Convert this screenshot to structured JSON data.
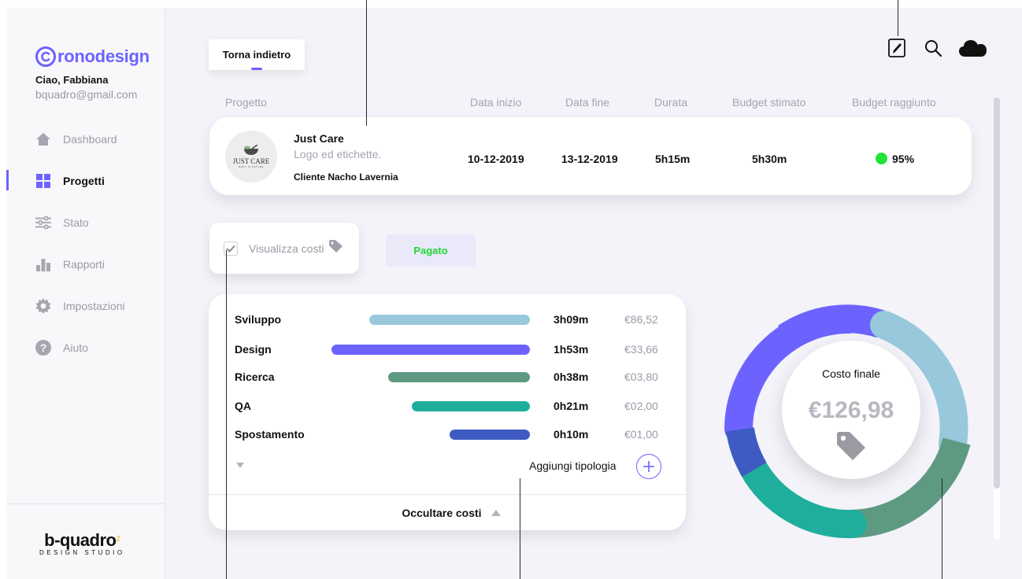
{
  "brand": {
    "name": "ronodesign",
    "color": "#6c63ff"
  },
  "user": {
    "greeting": "Ciao, Fabbiana",
    "email": "bquadro@gmail.com"
  },
  "sidebar": {
    "items": [
      {
        "label": "Dashboard",
        "icon": "home-icon",
        "active": false
      },
      {
        "label": "Progetti",
        "icon": "grid-icon",
        "active": true
      },
      {
        "label": "Stato",
        "icon": "sliders-icon",
        "active": false
      },
      {
        "label": "Rapporti",
        "icon": "bar-chart-icon",
        "active": false
      },
      {
        "label": "Impostazioni",
        "icon": "gear-icon",
        "active": false
      },
      {
        "label": "Aiuto",
        "icon": "help-icon",
        "active": false
      }
    ],
    "footer": {
      "brand": "b-quadro",
      "sup": "2",
      "tagline": "DESIGN STUDIO"
    }
  },
  "toolbar": {
    "back_label": "Torna indietro",
    "icons": [
      "edit-icon",
      "search-icon",
      "cloud-icon"
    ]
  },
  "table": {
    "headers": [
      "Progetto",
      "Data inizio",
      "Data fine",
      "Durata",
      "Budget stimato",
      "Budget raggiunto"
    ],
    "project": {
      "logo_text": "JUST CARE",
      "logo_subtext": "BODY IS NATURE",
      "name": "Just Care",
      "description": "Logo ed etichette.",
      "client": "Cliente Nacho Lavernia",
      "start": "10-12-2019",
      "end": "13-12-2019",
      "duration": "5h15m",
      "estimated_budget": "5h30m",
      "reached_budget": "95%",
      "status_color": "#22e33a"
    }
  },
  "costs_toggle": {
    "label": "Visualizza costi",
    "checked": true
  },
  "payment_badge": {
    "label": "Pagato",
    "color": "#22d63a"
  },
  "costs": {
    "rows": [
      {
        "name": "Sviluppo",
        "time": "3h09m",
        "cost": "€86,52",
        "color": "#98c8db",
        "share": 0.68
      },
      {
        "name": "Design",
        "time": "1h53m",
        "cost": "€33,66",
        "color": "#6c63ff",
        "share": 0.84
      },
      {
        "name": "Ricerca",
        "time": "0h38m",
        "cost": "€03,80",
        "color": "#5e9a82",
        "share": 0.6
      },
      {
        "name": "QA",
        "time": "0h21m",
        "cost": "€02,00",
        "color": "#1fae9c",
        "share": 0.5
      },
      {
        "name": "Spostamento",
        "time": "0h10m",
        "cost": "€01,00",
        "color": "#3d5bc2",
        "share": 0.34
      }
    ],
    "add_label": "Aggiungi tipologia",
    "hide_label": "Occultare costi"
  },
  "summary": {
    "label": "Costo finale",
    "value": "€126,98"
  }
}
